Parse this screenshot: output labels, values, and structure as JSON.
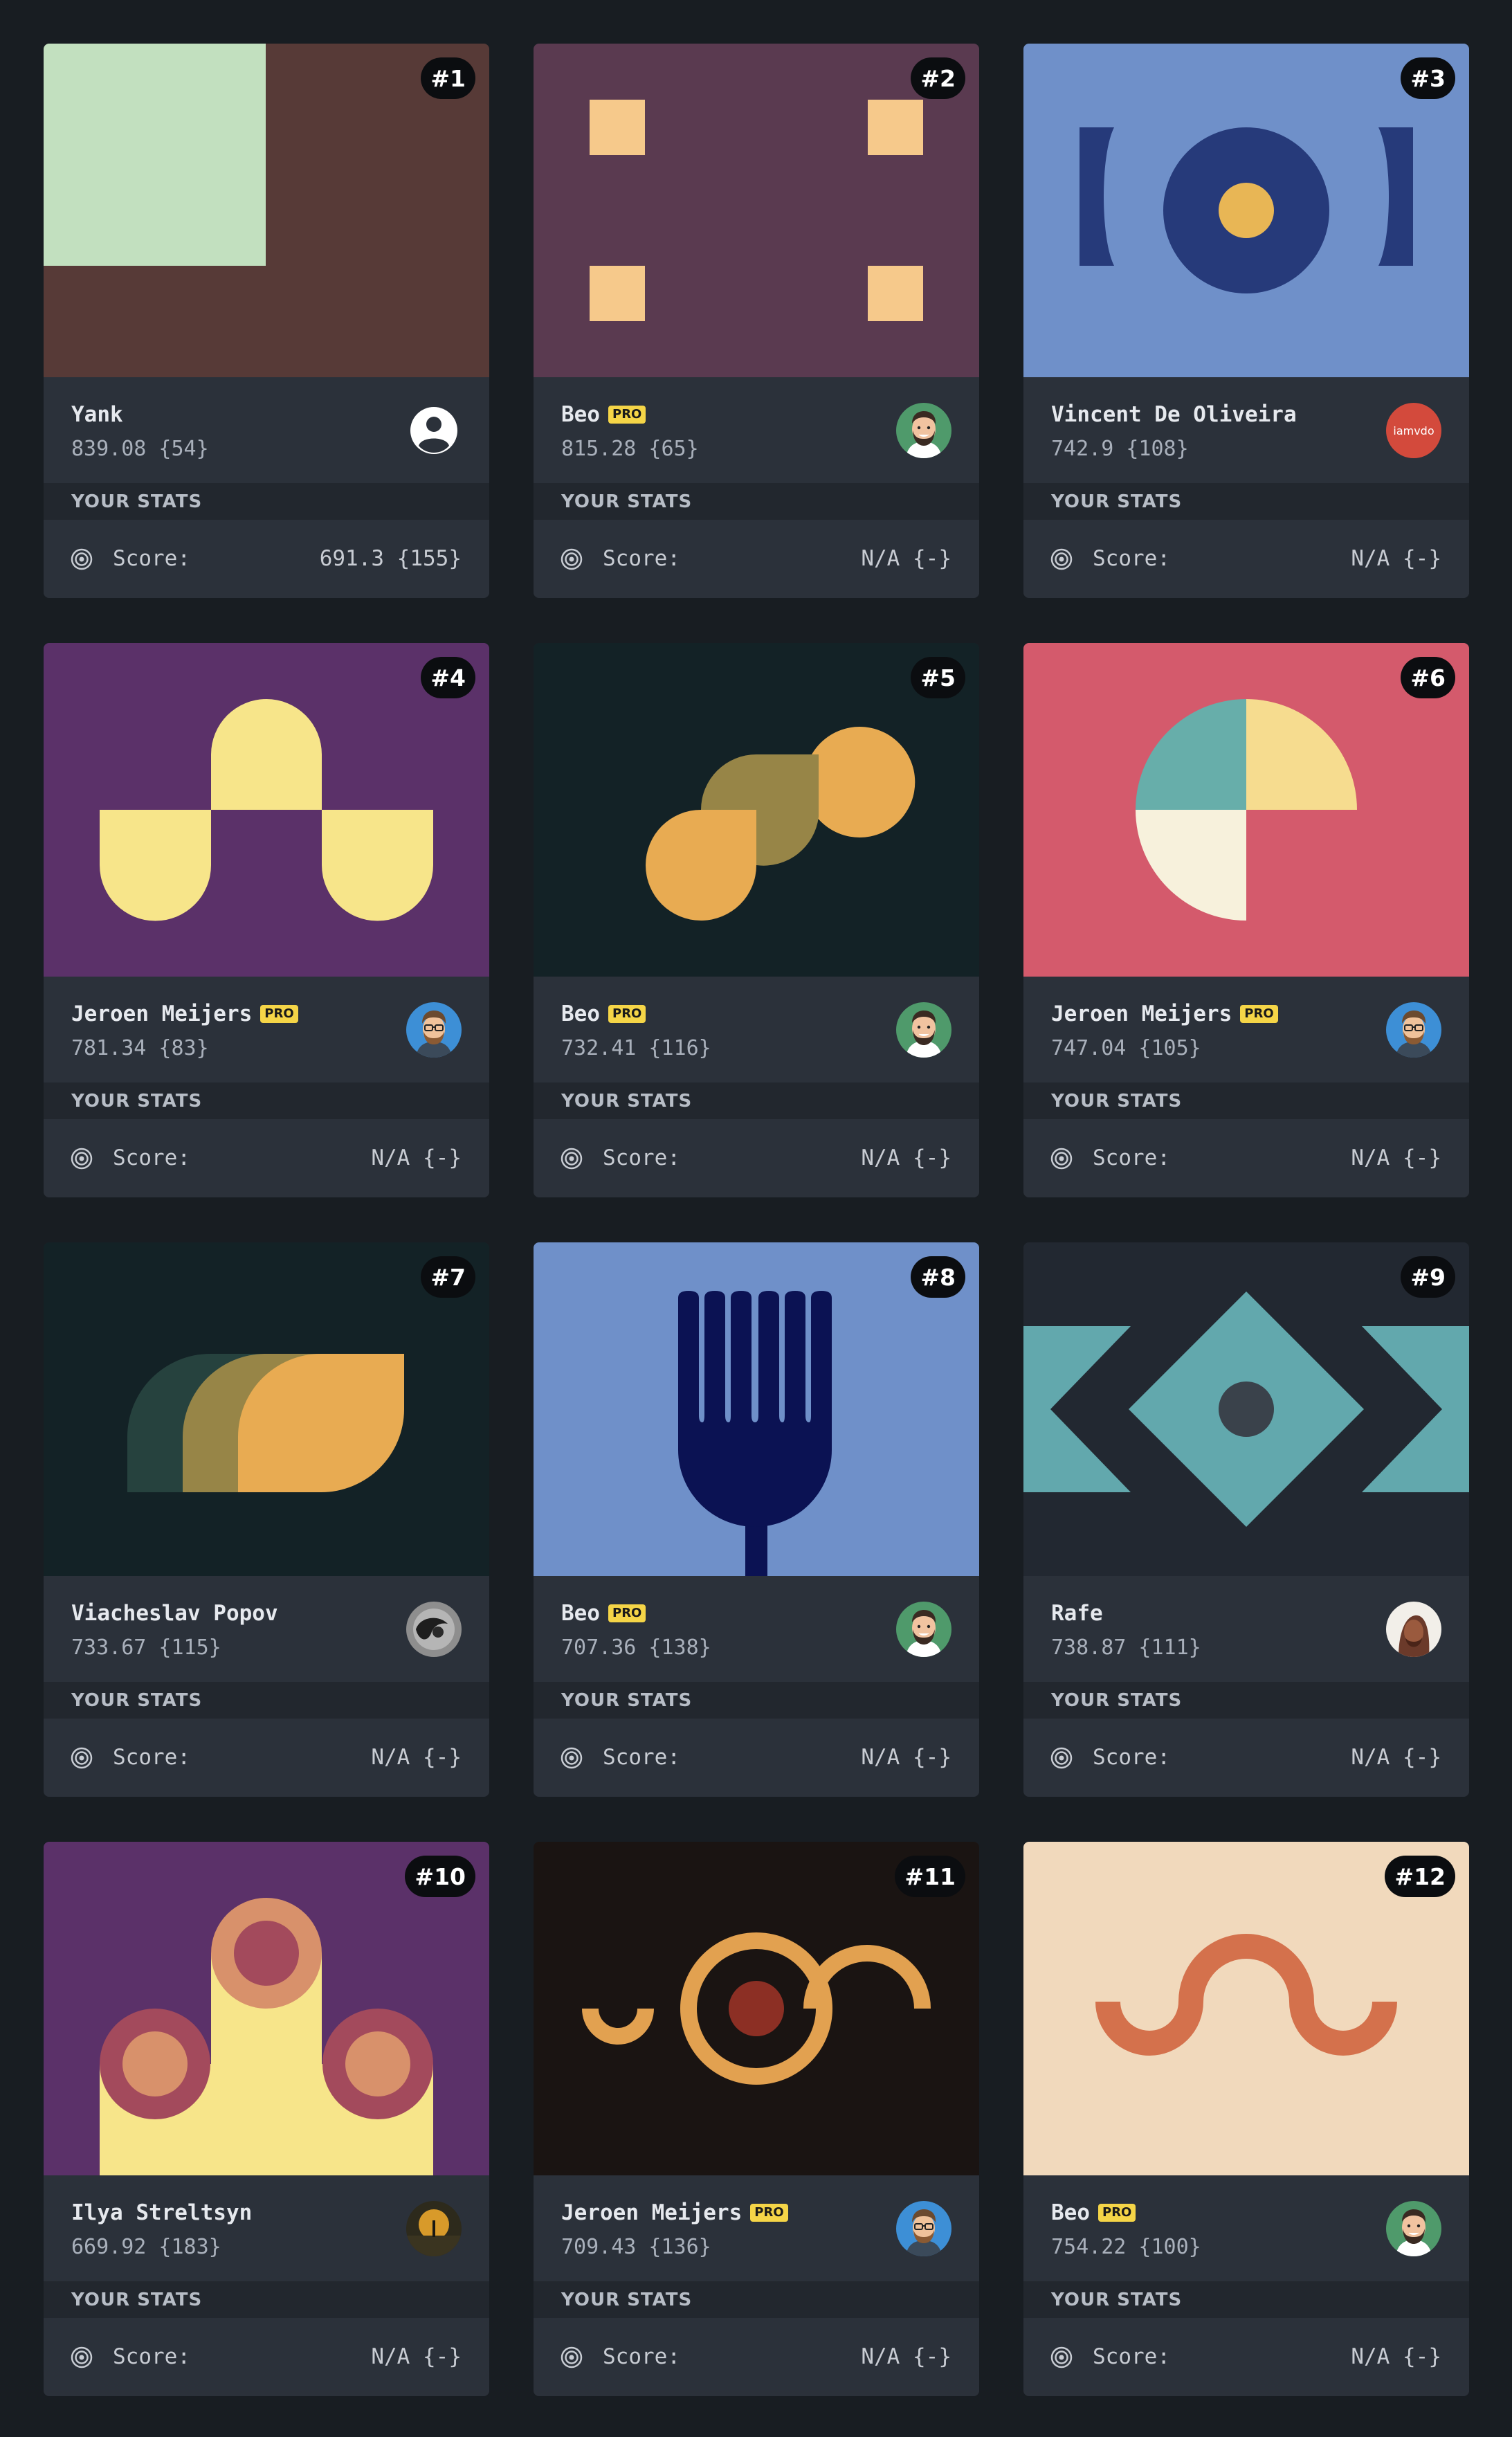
{
  "page": {
    "background": "#181d22",
    "pro_badge_color": "#f5d547"
  },
  "cards": [
    {
      "rank": "#1",
      "name": "Yank",
      "pro": false,
      "score_text": "839.08 {54}",
      "avatar_icon": "user-icon",
      "stats_heading": "YOUR STATS",
      "stat_label": "Score:",
      "stat_value": "691.3 {155}"
    },
    {
      "rank": "#2",
      "name": "Beo",
      "pro": true,
      "pro_label": "PRO",
      "score_text": "815.28 {65}",
      "avatar_icon": "avatar-beo",
      "stats_heading": "YOUR STATS",
      "stat_label": "Score:",
      "stat_value": "N/A {-}"
    },
    {
      "rank": "#3",
      "name": "Vincent De Oliveira",
      "pro": false,
      "score_text": "742.9 {108}",
      "avatar_icon": "avatar-iamvdo",
      "avatar_text": "iamvdo",
      "stats_heading": "YOUR STATS",
      "stat_label": "Score:",
      "stat_value": "N/A {-}"
    },
    {
      "rank": "#4",
      "name": "Jeroen Meijers",
      "pro": true,
      "pro_label": "PRO",
      "score_text": "781.34 {83}",
      "avatar_icon": "avatar-jeroen",
      "stats_heading": "YOUR STATS",
      "stat_label": "Score:",
      "stat_value": "N/A {-}"
    },
    {
      "rank": "#5",
      "name": "Beo",
      "pro": true,
      "pro_label": "PRO",
      "score_text": "732.41 {116}",
      "avatar_icon": "avatar-beo",
      "stats_heading": "YOUR STATS",
      "stat_label": "Score:",
      "stat_value": "N/A {-}"
    },
    {
      "rank": "#6",
      "name": "Jeroen Meijers",
      "pro": true,
      "pro_label": "PRO",
      "score_text": "747.04 {105}",
      "avatar_icon": "avatar-jeroen",
      "stats_heading": "YOUR STATS",
      "stat_label": "Score:",
      "stat_value": "N/A {-}"
    },
    {
      "rank": "#7",
      "name": "Viacheslav Popov",
      "pro": false,
      "score_text": "733.67 {115}",
      "avatar_icon": "avatar-viacheslav",
      "stats_heading": "YOUR STATS",
      "stat_label": "Score:",
      "stat_value": "N/A {-}"
    },
    {
      "rank": "#8",
      "name": "Beo",
      "pro": true,
      "pro_label": "PRO",
      "score_text": "707.36 {138}",
      "avatar_icon": "avatar-beo",
      "stats_heading": "YOUR STATS",
      "stat_label": "Score:",
      "stat_value": "N/A {-}"
    },
    {
      "rank": "#9",
      "name": "Rafe",
      "pro": false,
      "score_text": "738.87 {111}",
      "avatar_icon": "avatar-rafe",
      "stats_heading": "YOUR STATS",
      "stat_label": "Score:",
      "stat_value": "N/A {-}"
    },
    {
      "rank": "#10",
      "name": "Ilya Streltsyn",
      "pro": false,
      "score_text": "669.92 {183}",
      "avatar_icon": "avatar-ilya",
      "stats_heading": "YOUR STATS",
      "stat_label": "Score:",
      "stat_value": "N/A {-}"
    },
    {
      "rank": "#11",
      "name": "Jeroen Meijers",
      "pro": true,
      "pro_label": "PRO",
      "score_text": "709.43 {136}",
      "avatar_icon": "avatar-jeroen",
      "stats_heading": "YOUR STATS",
      "stat_label": "Score:",
      "stat_value": "N/A {-}"
    },
    {
      "rank": "#12",
      "name": "Beo",
      "pro": true,
      "pro_label": "PRO",
      "score_text": "754.22 {100}",
      "avatar_icon": "avatar-beo",
      "stats_heading": "YOUR STATS",
      "stat_label": "Score:",
      "stat_value": "N/A {-}"
    }
  ]
}
